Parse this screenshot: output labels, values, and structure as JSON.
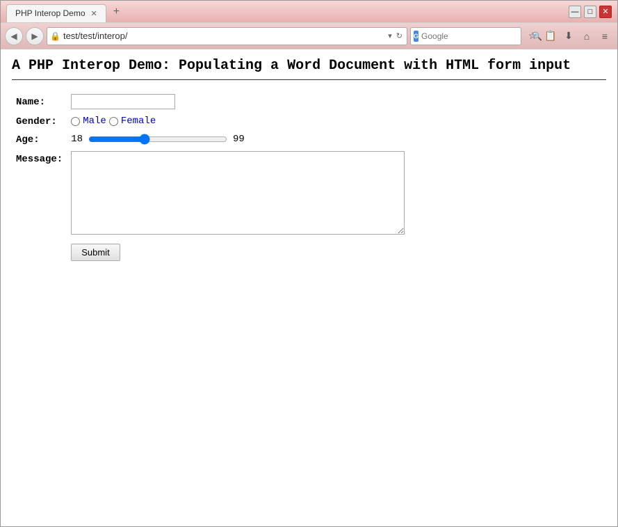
{
  "window": {
    "title": "PHP Interop Demo",
    "tab_label": "PHP Interop Demo",
    "new_tab_icon": "+",
    "minimize_icon": "—",
    "maximize_icon": "□",
    "close_icon": "✕"
  },
  "navbar": {
    "back_icon": "◀",
    "forward_icon": "▶",
    "address": "test/test/interop/",
    "refresh_icon": "↻",
    "search_placeholder": "Google",
    "google_icon": "G",
    "star_icon": "☆",
    "bookmark_icon": "📄",
    "download_icon": "⬇",
    "home_icon": "⌂",
    "menu_icon": "≡"
  },
  "page": {
    "heading": "A PHP Interop Demo: Populating a Word Document with HTML form input",
    "form": {
      "name_label": "Name:",
      "name_placeholder": "",
      "gender_label": "Gender:",
      "gender_options": [
        {
          "value": "male",
          "label": "Male"
        },
        {
          "value": "female",
          "label": "Female"
        }
      ],
      "age_label": "Age:",
      "age_min": "18",
      "age_max": "99",
      "age_default": 50,
      "message_label": "Message:",
      "submit_label": "Submit"
    }
  }
}
